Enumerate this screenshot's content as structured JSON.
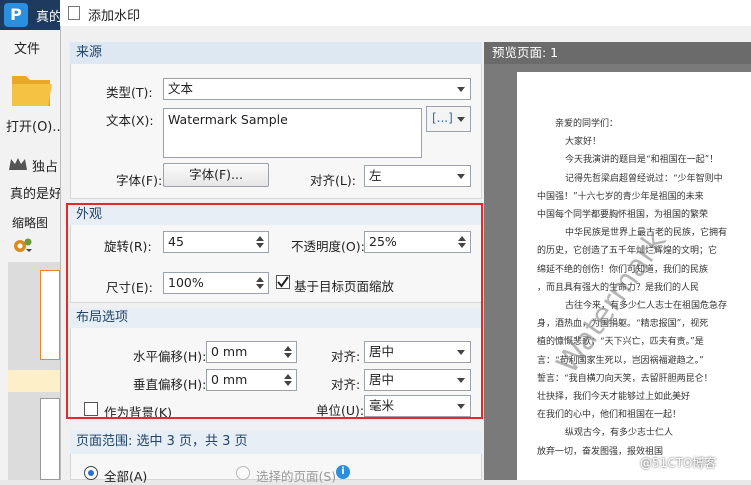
{
  "app": {
    "title": "真的",
    "logo_letter": "P",
    "menu_file": "文件",
    "open_label": "打开(O)...",
    "exclusive_label": "独占",
    "doc_tab": "真的是好",
    "thumbnails_label": "缩略图",
    "selected_color": "#fdf0c8"
  },
  "dialog": {
    "title": "添加水印",
    "source": {
      "header": "来源",
      "type_label": "类型(T):",
      "type_value": "文本",
      "text_label": "文本(X):",
      "text_value": "Watermark Sample",
      "insert_icon_text": "[...]",
      "font_label": "字体(F):",
      "font_button": "字体(F)...",
      "align_label": "对齐(L):",
      "align_value": "左"
    },
    "appearance": {
      "header": "外观",
      "rotation_label": "旋转(R):",
      "rotation_value": "45",
      "opacity_label": "不透明度(O):",
      "opacity_value": "25%",
      "size_label": "尺寸(E):",
      "size_value": "100%",
      "scale_checkbox_label": "基于目标页面缩放",
      "scale_checked": true
    },
    "layout": {
      "header": "布局选项",
      "h_offset_label": "水平偏移(H):",
      "h_offset_value": "0 mm",
      "h_align_label": "对齐:",
      "h_align_value": "居中",
      "v_offset_label": "垂直偏移(H):",
      "v_offset_value": "0 mm",
      "v_align_label": "对齐:",
      "v_align_value": "居中",
      "background_label": "作为背景(K)",
      "background_checked": false,
      "unit_label": "单位(U):",
      "unit_value": "毫米"
    },
    "page_range": {
      "header": "页面范围: 选中 3 页，共 3 页",
      "all_label": "全部(A)",
      "selected_pages_label": "选择的页面(S)",
      "all_selected": true
    },
    "highlight_color": "#e12b2b"
  },
  "preview": {
    "header": "预览页面: 1",
    "watermark_text": "Watermark",
    "lines": [
      "亲爱的同学们：",
      "大家好！",
      "今天我演讲的题目是“和祖国在一起”！",
      "记得先哲梁启超曾经说过：“少年智则中",
      "中国强！”十六七岁的青少年是祖国的未来",
      "中国每个同学都要胸怀祖国，为祖国的繁荣",
      "中华民族是世界上最古老的民族，它拥有",
      "的历史，它创造了五千年灿烂辉煌的文明；它",
      "绵延不绝的创伤！你们可知道，我们的民族",
      "，而且具有强大的生命力？是我们的人民",
      "古往今来，有多少仁人志士在祖国危急存",
      "身，酒热血，为国捐躯。“精忠报国”，视死",
      "植的慷慨悲歌；“天下兴亡，匹夫有责。”是",
      "言：“苟利国家生死以，岂因祸福避趋之。”",
      "誓言：“我自横刀向天笑，去留肝胆两昆仑！",
      "壮抉择，我们今天才能够过上如此美好",
      "在我们的心中，他们和祖国在一起！",
      "纵观古今，有多少志士仁人",
      "放弃一切，奋发图强，报效祖国"
    ],
    "corner_brand": "@51CTO博客"
  }
}
